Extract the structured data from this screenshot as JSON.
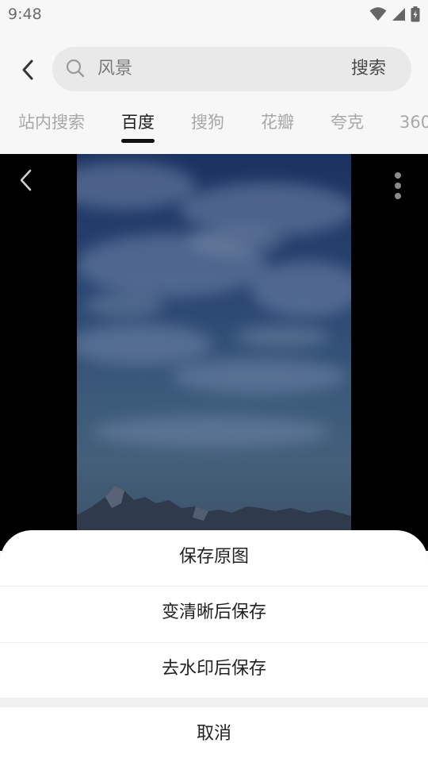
{
  "status_bar": {
    "time": "9:48",
    "icons": [
      "wifi-icon",
      "signal-icon",
      "battery-charging-icon"
    ]
  },
  "search": {
    "back_icon": "back-arrow-icon",
    "search_icon": "search-icon",
    "query": "风景",
    "submit_label": "搜索"
  },
  "tabs": [
    {
      "label": "站内搜索",
      "active": false
    },
    {
      "label": "百度",
      "active": true
    },
    {
      "label": "搜狗",
      "active": false
    },
    {
      "label": "花瓣",
      "active": false
    },
    {
      "label": "夸克",
      "active": false
    },
    {
      "label": "360",
      "active": false
    }
  ],
  "viewer": {
    "back_icon": "chevron-left-icon",
    "more_icon": "more-vertical-icon"
  },
  "sheet": {
    "options": [
      {
        "label": "保存原图"
      },
      {
        "label": "变清晰后保存"
      },
      {
        "label": "去水印后保存"
      }
    ],
    "cancel_label": "取消"
  },
  "colors": {
    "accent": "#111111",
    "inactive_tab": "#a8a8a8",
    "overlay_bg": "#000000"
  }
}
